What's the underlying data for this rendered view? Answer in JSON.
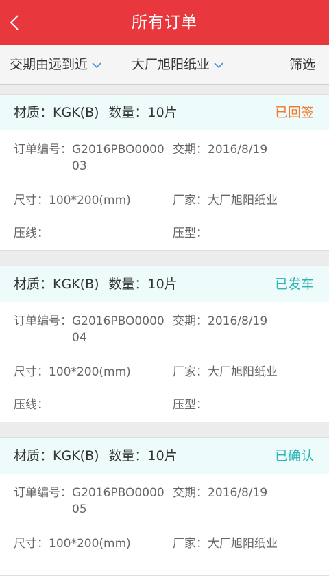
{
  "header": {
    "title": "所有订单",
    "back_icon": "chevron-left-icon"
  },
  "filters": {
    "sort_label": "交期由远到近",
    "factory_label": "大厂旭阳纸业",
    "filter_button": "筛选",
    "chevron_color": "#4a90d9"
  },
  "colors": {
    "accent": "#e8373d",
    "status_signed": "#f07a2a",
    "status_shipped": "#2bb5b5",
    "status_confirmed": "#2bb5b5"
  },
  "labels": {
    "material_prefix": "材质：",
    "quantity_prefix": "数量：",
    "order_no_prefix": "订单编号：",
    "delivery_prefix": "交期：",
    "size_prefix": "尺寸：",
    "factory_prefix": "厂家：",
    "crease_prefix": "压线：",
    "press_prefix": "压型："
  },
  "orders": [
    {
      "material": "KGK(B)",
      "quantity": "10片",
      "status": "已回签",
      "status_color": "#f07a2a",
      "order_no": "G2016PBO000003",
      "delivery": "2016/8/19",
      "size": "100*200(mm)",
      "factory": "大厂旭阳纸业",
      "crease": "",
      "press": ""
    },
    {
      "material": "KGK(B)",
      "quantity": "10片",
      "status": "已发车",
      "status_color": "#2bb5b5",
      "order_no": "G2016PBO000004",
      "delivery": "2016/8/19",
      "size": "100*200(mm)",
      "factory": "大厂旭阳纸业",
      "crease": "",
      "press": ""
    },
    {
      "material": "KGK(B)",
      "quantity": "10片",
      "status": "已确认",
      "status_color": "#2bb5b5",
      "order_no": "G2016PBO000005",
      "delivery": "2016/8/19",
      "size": "100*200(mm)",
      "factory": "大厂旭阳纸业",
      "crease": "",
      "press": ""
    }
  ]
}
